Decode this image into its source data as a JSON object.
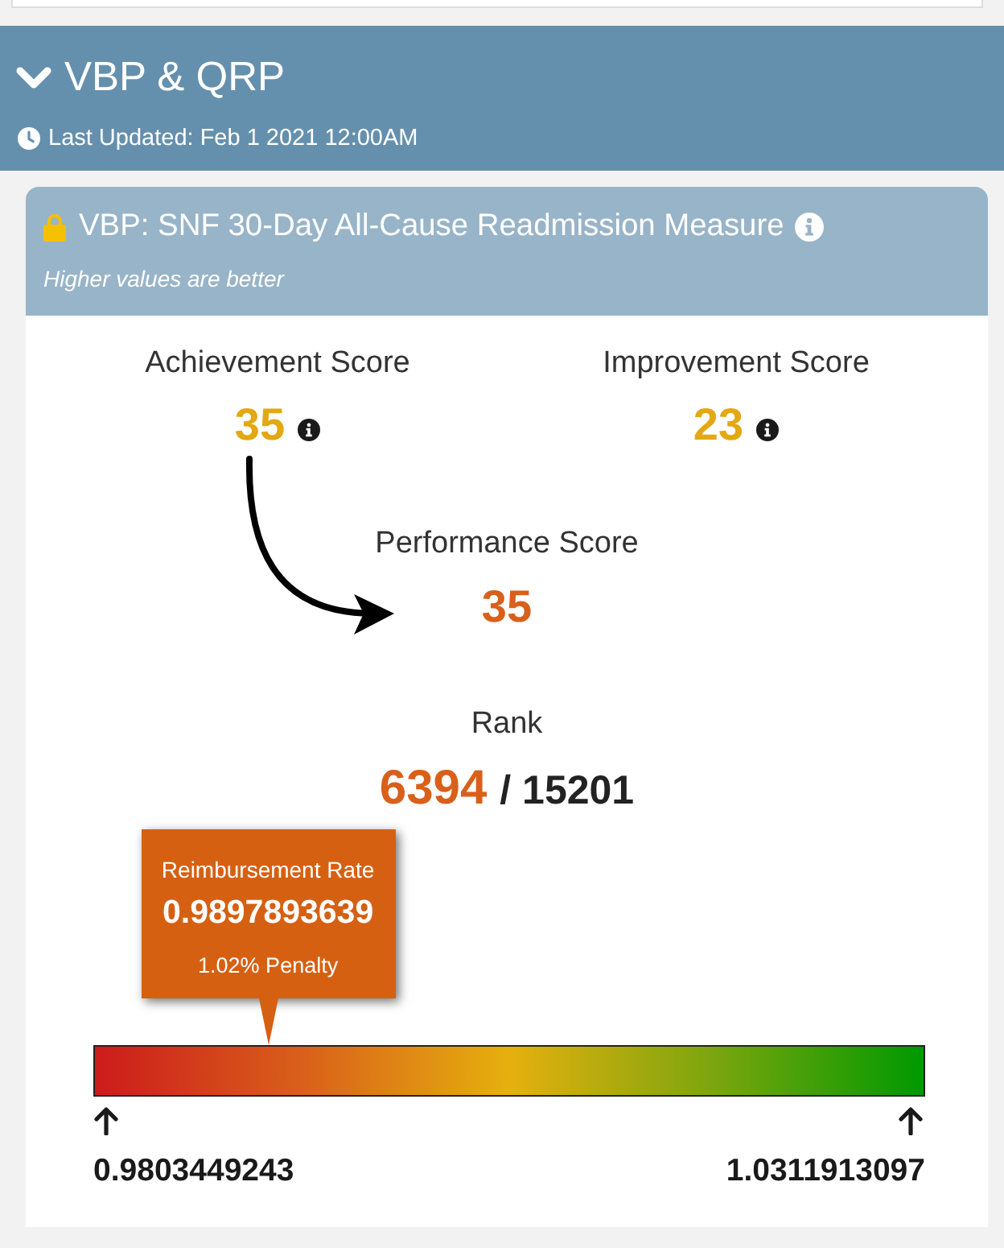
{
  "section": {
    "title": "VBP & QRP",
    "expanded": true,
    "last_updated": "Last Updated: Feb 1 2021 12:00AM"
  },
  "card": {
    "title": "VBP: SNF 30-Day All-Cause Readmission Measure",
    "locked": true,
    "info": true,
    "subtitle": "Higher values are better"
  },
  "scores": [
    {
      "label": "Achievement Score",
      "value": "35",
      "info": true
    },
    {
      "label": "Improvement Score",
      "value": "23",
      "info": true
    }
  ],
  "performance": {
    "label": "Performance Score",
    "value": "35"
  },
  "rank": {
    "label": "Rank",
    "value": "6394",
    "total": "/ 15201"
  },
  "reimbursement": {
    "label": "Reimbursement Rate",
    "value": "0.9897893639",
    "note": "1.02% Penalty",
    "level": 0.21
  },
  "scale": {
    "min": "0.9803449243",
    "max": "1.0311913097"
  }
}
